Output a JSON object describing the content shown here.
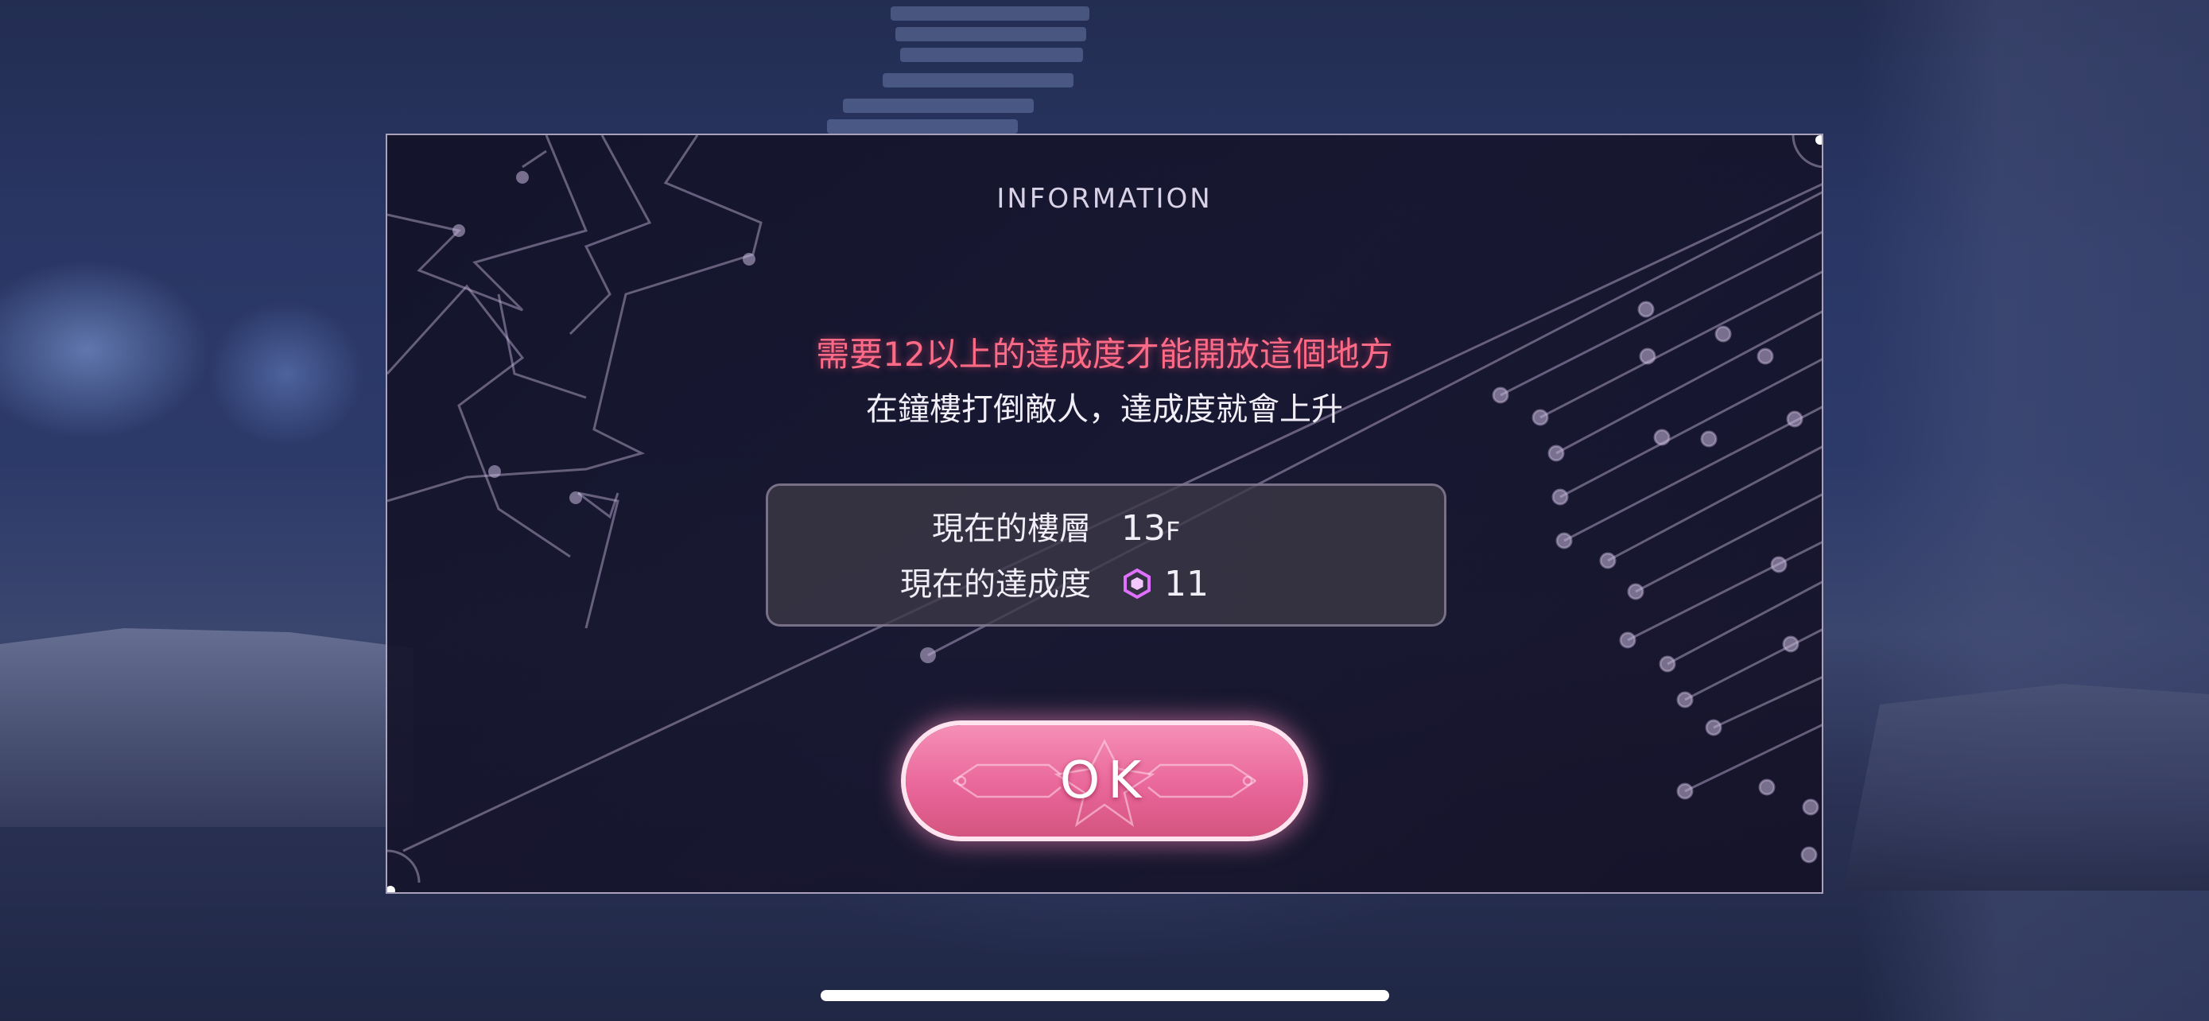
{
  "dialog": {
    "title": "INFORMATION",
    "message_requirement": "需要12以上的達成度才能開放這個地方",
    "message_hint": "在鐘樓打倒敵人，達成度就會上升",
    "info": {
      "floor_label": "現在的樓層",
      "floor_value": "13",
      "floor_unit": "F",
      "achievement_label": "現在的達成度",
      "achievement_value": "11",
      "achievement_icon": "hexagon-gem-icon"
    },
    "ok_label": "OK"
  },
  "colors": {
    "accent_red": "#ff6b86",
    "button_pink": "#e9679a",
    "gem_purple": "#e070ff"
  }
}
